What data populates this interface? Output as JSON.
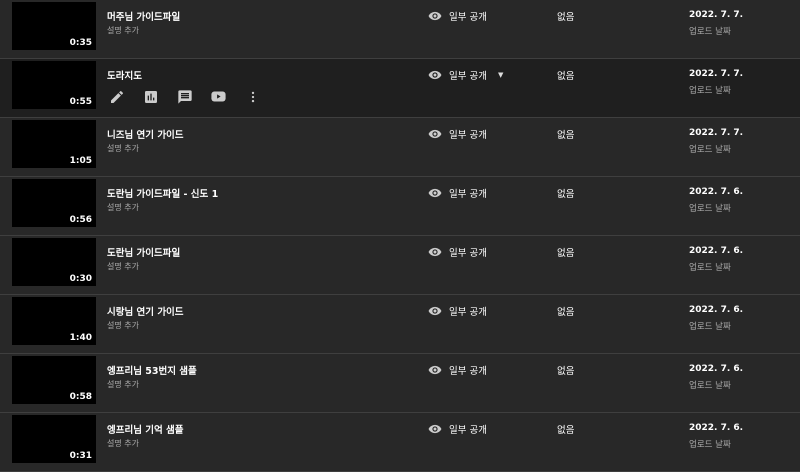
{
  "rows": [
    {
      "title": "머주님 가이드파일",
      "description": "설명 추가",
      "duration": "0:35",
      "visibility": "일부 공개",
      "restrictions": "없음",
      "date": "2022. 7. 7.",
      "date_label": "업로드 날짜"
    },
    {
      "title": "도라지도",
      "description": "",
      "duration": "0:55",
      "visibility": "일부 공개",
      "restrictions": "없음",
      "date": "2022. 7. 7.",
      "date_label": "업로드 날짜"
    },
    {
      "title": "니즈님 연기 가이드",
      "description": "설명 추가",
      "duration": "1:05",
      "visibility": "일부 공개",
      "restrictions": "없음",
      "date": "2022. 7. 7.",
      "date_label": "업로드 날짜"
    },
    {
      "title": "도란님 가이드파일 - 신도 1",
      "description": "설명 추가",
      "duration": "0:56",
      "visibility": "일부 공개",
      "restrictions": "없음",
      "date": "2022. 7. 6.",
      "date_label": "업로드 날짜"
    },
    {
      "title": "도란님 가이드파일",
      "description": "설명 추가",
      "duration": "0:30",
      "visibility": "일부 공개",
      "restrictions": "없음",
      "date": "2022. 7. 6.",
      "date_label": "업로드 날짜"
    },
    {
      "title": "시랑님 연기 가이드",
      "description": "설명 추가",
      "duration": "1:40",
      "visibility": "일부 공개",
      "restrictions": "없음",
      "date": "2022. 7. 6.",
      "date_label": "업로드 날짜"
    },
    {
      "title": "엥프리님 53번지 샘플",
      "description": "설명 추가",
      "duration": "0:58",
      "visibility": "일부 공개",
      "restrictions": "없음",
      "date": "2022. 7. 6.",
      "date_label": "업로드 날짜"
    },
    {
      "title": "엥프리님 기억 샘플",
      "description": "설명 추가",
      "duration": "0:31",
      "visibility": "일부 공개",
      "restrictions": "없음",
      "date": "2022. 7. 6.",
      "date_label": "업로드 날짜"
    }
  ],
  "active_row_actions": [
    "pencil-icon",
    "analytics-icon",
    "comments-icon",
    "youtube-icon",
    "more-vert-icon"
  ],
  "colors": {
    "background": "#282828",
    "active_row": "#1f1f1f",
    "divider": "#3f3f3f",
    "secondary_text": "#aaaaaa"
  }
}
